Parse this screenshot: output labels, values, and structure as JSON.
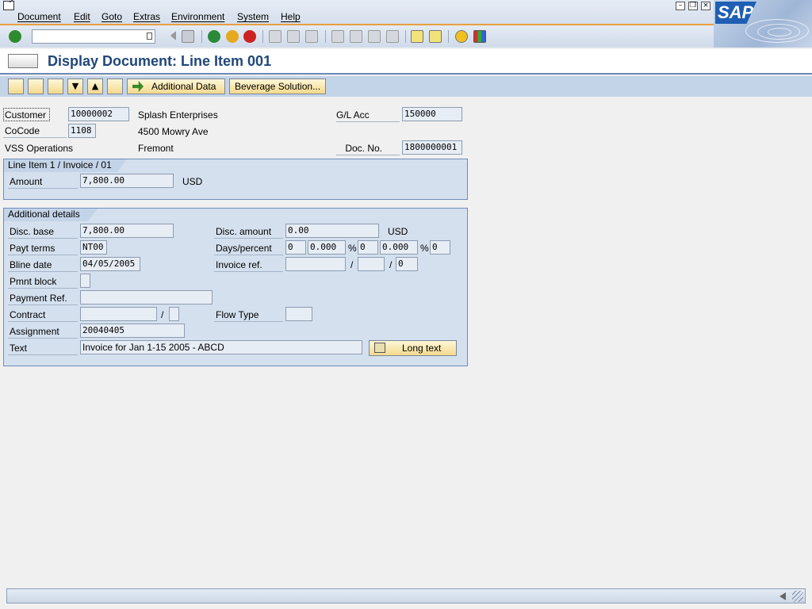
{
  "menu": {
    "items": [
      "Document",
      "Edit",
      "Goto",
      "Extras",
      "Environment",
      "System",
      "Help"
    ]
  },
  "brand": {
    "logo": "SAP",
    "accent": "#e8a040",
    "title_color": "#21477a"
  },
  "command_field": {
    "value": ""
  },
  "title": "Display Document: Line Item 001",
  "app_toolbar": {
    "additional_data": "Additional Data",
    "beverage_solution": "Beverage Solution..."
  },
  "header": {
    "customer_label": "Customer",
    "customer": "10000002",
    "customer_name": "Splash Enterprises",
    "street": "4500 Mowry Ave",
    "gl_acc_label": "G/L Acc",
    "gl_acc": "150000",
    "cocode_label": "CoCode",
    "cocode": "1108",
    "company_name": "VSS Operations",
    "city": "Fremont",
    "doc_no_label": "Doc. No.",
    "doc_no": "1800000001"
  },
  "line_item": {
    "group_title": "Line Item 1 / Invoice / 01",
    "amount_label": "Amount",
    "amount": "7,800.00",
    "currency": "USD"
  },
  "details": {
    "group_title": "Additional details",
    "disc_base_label": "Disc. base",
    "disc_base": "7,800.00",
    "disc_amount_label": "Disc. amount",
    "disc_amount": "0.00",
    "disc_currency": "USD",
    "payt_terms_label": "Payt terms",
    "payt_terms": "NT00",
    "days_percent_label": "Days/percent",
    "days1": "0",
    "pct1": "0.000",
    "days2": "0",
    "pct2": "0.000",
    "days3": "0",
    "pct_sign": "%",
    "bline_date_label": "Bline date",
    "bline_date": "04/05/2005",
    "invoice_ref_label": "Invoice ref.",
    "invoice_ref": "",
    "invoice_ref_year": "",
    "invoice_ref_item": "0",
    "slash": "/",
    "pmnt_block_label": "Pmnt block",
    "pmnt_block": "",
    "payment_ref_label": "Payment Ref.",
    "payment_ref": "",
    "contract_label": "Contract",
    "contract": "",
    "contract_type": "",
    "flow_type_label": "Flow Type",
    "flow_type": "",
    "assignment_label": "Assignment",
    "assignment": "20040405",
    "text_label": "Text",
    "text": "Invoice for Jan 1-15 2005 - ABCD",
    "long_text_button": "Long text"
  },
  "icons": {
    "toolbar": [
      "enter-icon",
      "back-icon",
      "exit-icon",
      "cancel-icon",
      "print-icon",
      "find-icon",
      "find-next-icon",
      "first-page-icon",
      "previous-page-icon",
      "next-page-icon",
      "last-page-icon",
      "create-session-icon",
      "shortcut-icon",
      "help-icon",
      "layout-menu-icon"
    ],
    "app": [
      "display-change-icon",
      "document-overview-icon",
      "customer-icon",
      "next-item-icon",
      "previous-item-icon",
      "reset-icon"
    ]
  }
}
